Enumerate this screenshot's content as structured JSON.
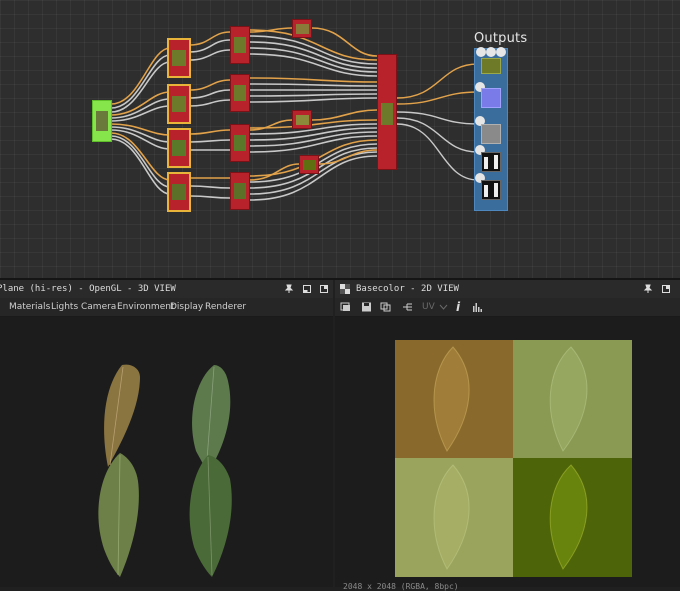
{
  "graph": {
    "outputs_label": "Outputs"
  },
  "view3d": {
    "title": "Plane (hi-res) - OpenGL - 3D VIEW",
    "menu": [
      "Materials",
      "Lights",
      "Camera",
      "Environment",
      "Display",
      "Renderer"
    ]
  },
  "view2d": {
    "title": "Basecolor - 2D VIEW",
    "uv_label": "UV",
    "info_label": "i",
    "status": "2048 x 2048 (RGBA, 8bpc)"
  },
  "colors": {
    "input_node": "#86e54a",
    "selected_frame": "#e8b43a",
    "red_node": "#b8222a",
    "outputs_frame": "#3a6c9c",
    "wire_orange": "#e2a24a",
    "wire_gray": "#c8c8c8"
  },
  "texture_quadrants": [
    "#8a6a2c",
    "#8a9a52",
    "#9ba45c",
    "#4e6408"
  ]
}
